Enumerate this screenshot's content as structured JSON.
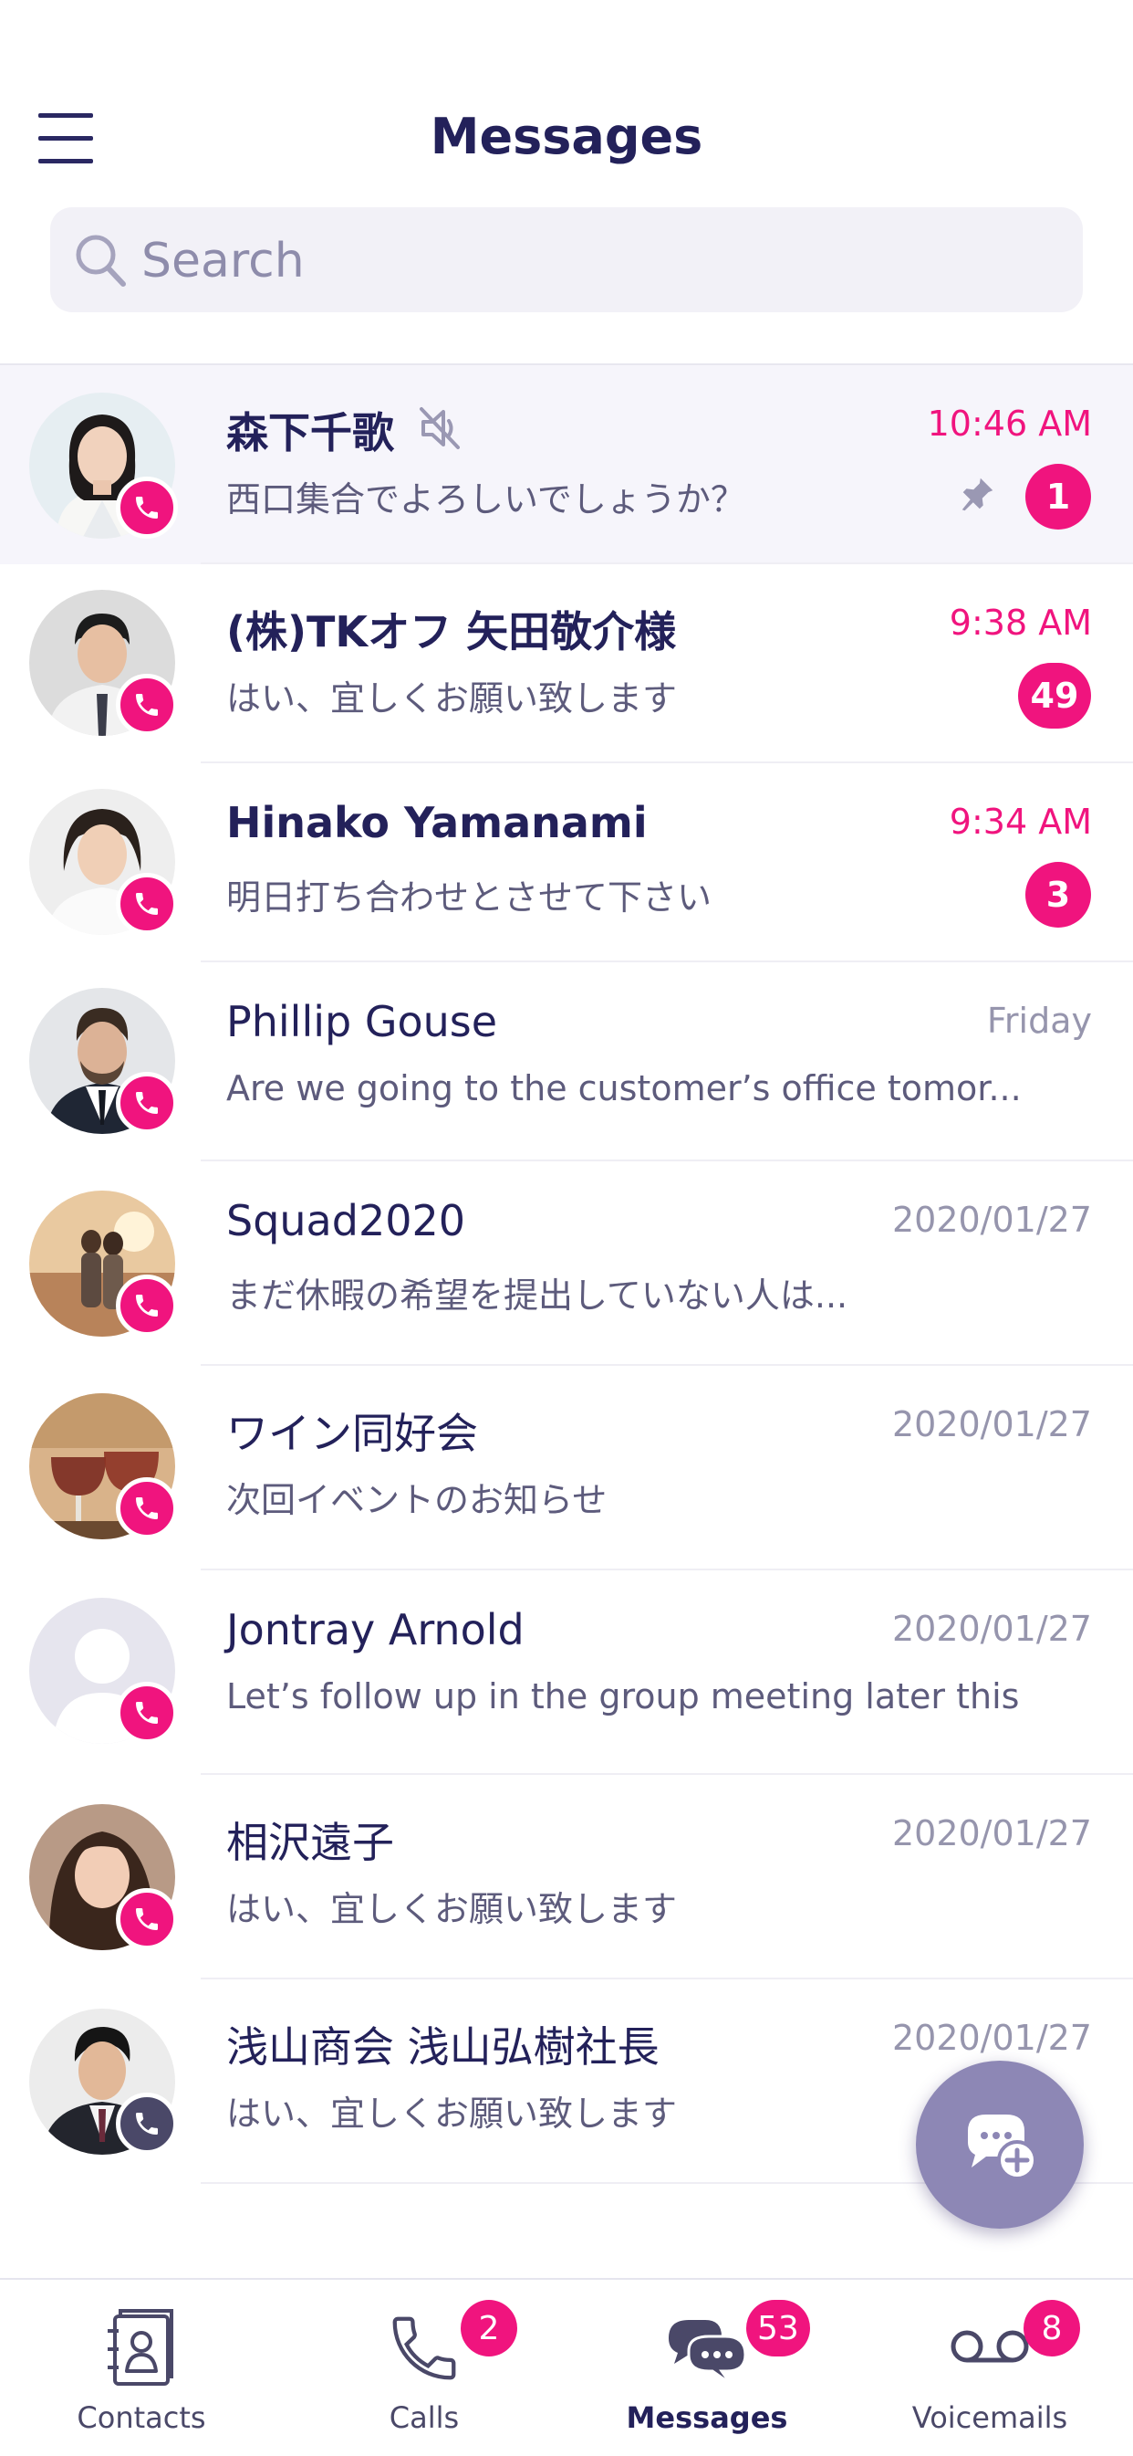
{
  "header": {
    "title": "Messages"
  },
  "search": {
    "placeholder": "Search"
  },
  "conversations": [
    {
      "name": "森下千歌",
      "time": "10:46 AM",
      "preview": "西口集合でよろしいでしょうか？",
      "unread_count": "1",
      "muted": true,
      "pinned": true,
      "unread": true,
      "avatar_icon": "woman-photo-avatar",
      "phone_badge": "pink"
    },
    {
      "name": "(株)TKオフ 矢田敬介様",
      "time": "9:38 AM",
      "preview": "はい、宜しくお願い致します",
      "unread_count": "49",
      "unread": true,
      "avatar_icon": "man-photo-avatar",
      "phone_badge": "pink"
    },
    {
      "name": "Hinako Yamanami",
      "time": "9:34 AM",
      "preview": "明日打ち合わせとさせて下さい",
      "unread_count": "3",
      "unread": true,
      "avatar_icon": "woman-photo-avatar",
      "phone_badge": "pink"
    },
    {
      "name": "Phillip Gouse",
      "time": "Friday",
      "preview": "Are we going to the customer’s office tomor...",
      "avatar_icon": "man-photo-avatar",
      "phone_badge": "pink"
    },
    {
      "name": "Squad2020",
      "time": "2020/01/27",
      "preview": "まだ休暇の希望を提出していない人は...",
      "avatar_icon": "group-photo-avatar",
      "phone_badge": "pink"
    },
    {
      "name": "ワイン同好会",
      "time": "2020/01/27",
      "preview": "次回イベントのお知らせ",
      "avatar_icon": "wine-photo-avatar",
      "phone_badge": "pink"
    },
    {
      "name": "Jontray Arnold",
      "time": "2020/01/27",
      "preview": "Let’s follow up in the group meeting later this ev...",
      "avatar_icon": "default-person-avatar",
      "phone_badge": "pink"
    },
    {
      "name": "相沢遠子",
      "time": "2020/01/27",
      "preview": "はい、宜しくお願い致します",
      "avatar_icon": "woman-photo-avatar",
      "phone_badge": "pink"
    },
    {
      "name": "浅山商会 浅山弘樹社長",
      "time": "2020/01/27",
      "preview": "はい、宜しくお願い致します",
      "avatar_icon": "man-photo-avatar",
      "phone_badge": "gray"
    }
  ],
  "tabs": [
    {
      "label": "Contacts",
      "icon": "contacts-icon",
      "badge": ""
    },
    {
      "label": "Calls",
      "icon": "phone-icon",
      "badge": "2"
    },
    {
      "label": "Messages",
      "icon": "chat-icon",
      "badge": "53",
      "active": true
    },
    {
      "label": "Voicemails",
      "icon": "voicemail-icon",
      "badge": "8"
    }
  ],
  "colors": {
    "accent": "#f0147e",
    "primary_text": "#23215a",
    "fab": "#8d87b5",
    "pinned_row": "#f6f5fb"
  }
}
